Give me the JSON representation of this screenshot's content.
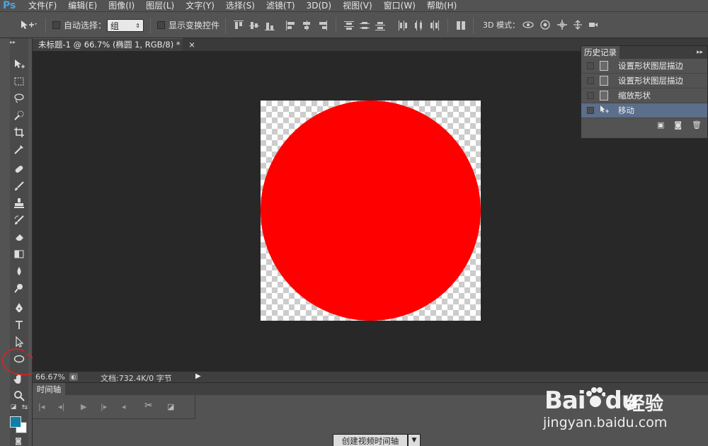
{
  "app": {
    "logo": "Ps"
  },
  "menu": [
    "文件(F)",
    "编辑(E)",
    "图像(I)",
    "图层(L)",
    "文字(Y)",
    "选择(S)",
    "滤镜(T)",
    "3D(D)",
    "视图(V)",
    "窗口(W)",
    "帮助(H)"
  ],
  "options": {
    "auto_select_label": "自动选择：",
    "auto_select_value": "组",
    "show_transform_label": "显示变换控件",
    "mode_3d_label": "3D 模式："
  },
  "document_tab": {
    "title": "未标题-1 @ 66.7% (椭圆 1, RGB/8) *",
    "close": "×"
  },
  "colors": {
    "shape_fill": "#ff0000",
    "foreground": "#0e7fa8",
    "background": "#ffffff",
    "annotation": "#e02020"
  },
  "history": {
    "title": "历史记录",
    "items": [
      {
        "label": "设置形状图层描边",
        "active": false
      },
      {
        "label": "设置形状图层描边",
        "active": false
      },
      {
        "label": "缩放形状",
        "active": false
      },
      {
        "label": "移动",
        "active": true
      }
    ]
  },
  "status": {
    "zoom": "66.67%",
    "doc_info": "文档:732.4K/0 字节"
  },
  "timeline": {
    "tab": "时间轴",
    "create_button": "创建视频时间轴"
  },
  "watermark": {
    "logo": "Bai",
    "logo2": "du",
    "cn": "经验",
    "url": "jingyan.baidu.com"
  }
}
